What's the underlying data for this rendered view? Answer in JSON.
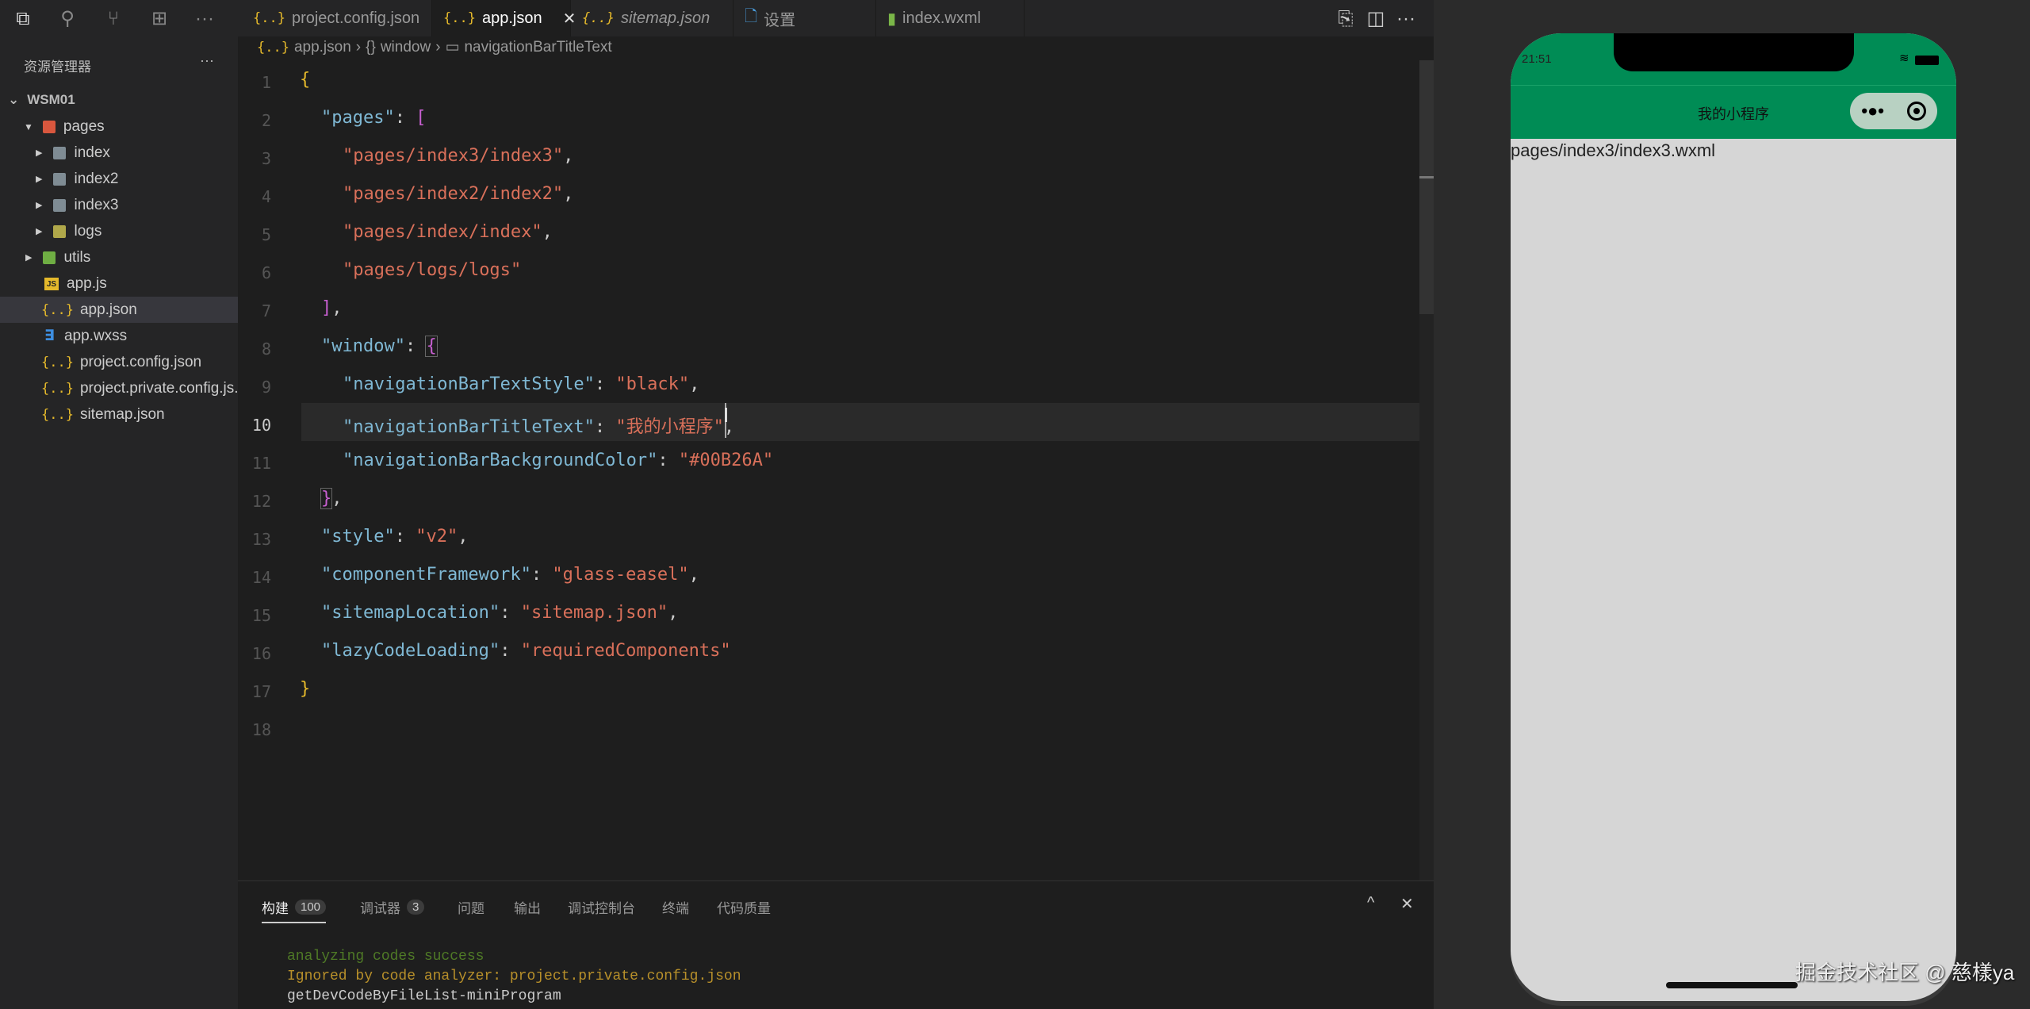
{
  "activity": [
    "explorer-icon",
    "search-icon",
    "source-control-icon",
    "extensions-icon",
    "more-icon"
  ],
  "tabs": [
    {
      "label": "project.config.json",
      "icon": "json"
    },
    {
      "label": "app.json",
      "icon": "json",
      "active": true
    },
    {
      "label": "sitemap.json",
      "icon": "json"
    },
    {
      "label": "设置",
      "icon": "file"
    },
    {
      "label": "index.wxml",
      "icon": "wxml"
    }
  ],
  "breadcrumb": {
    "file": "app.json",
    "seg1": "window",
    "seg2": "navigationBarTitleText"
  },
  "sidebar": {
    "title": "资源管理器",
    "root": "WSM01",
    "items": [
      {
        "label": "pages"
      },
      {
        "label": "index"
      },
      {
        "label": "index2"
      },
      {
        "label": "index3"
      },
      {
        "label": "logs"
      },
      {
        "label": "utils"
      },
      {
        "label": "app.js"
      },
      {
        "label": "app.json"
      },
      {
        "label": "app.wxss"
      },
      {
        "label": "project.config.json"
      },
      {
        "label": "project.private.config.js..."
      },
      {
        "label": "sitemap.json"
      }
    ]
  },
  "code": {
    "pages_key": "pages",
    "pages": [
      "pages/index3/index3",
      "pages/index2/index2",
      "pages/index/index",
      "pages/logs/logs"
    ],
    "window_key": "window",
    "w": [
      {
        "k": "navigationBarTextStyle",
        "v": "black"
      },
      {
        "k": "navigationBarTitleText",
        "v": "我的小程序"
      },
      {
        "k": "navigationBarBackgroundColor",
        "v": "#00B26A"
      }
    ],
    "top": [
      {
        "k": "style",
        "v": "v2"
      },
      {
        "k": "componentFramework",
        "v": "glass-easel"
      },
      {
        "k": "sitemapLocation",
        "v": "sitemap.json"
      },
      {
        "k": "lazyCodeLoading",
        "v": "requiredComponents"
      }
    ]
  },
  "panel": {
    "tabs": [
      {
        "label": "构建",
        "badge": "100"
      },
      {
        "label": "调试器",
        "badge": "3"
      },
      {
        "label": "问题"
      },
      {
        "label": "输出"
      },
      {
        "label": "调试控制台"
      },
      {
        "label": "终端"
      },
      {
        "label": "代码质量"
      }
    ],
    "logs": [
      "analyzing codes success",
      "Ignored by code analyzer: project.private.config.json",
      "getDevCodeByFileList-miniProgram"
    ]
  },
  "phone": {
    "time": "21:51",
    "title": "我的小程序",
    "content": "pages/index3/index3.wxml",
    "nav_color": "#008c55"
  },
  "watermark": "掘金技术社区 @ 慈樣ya"
}
